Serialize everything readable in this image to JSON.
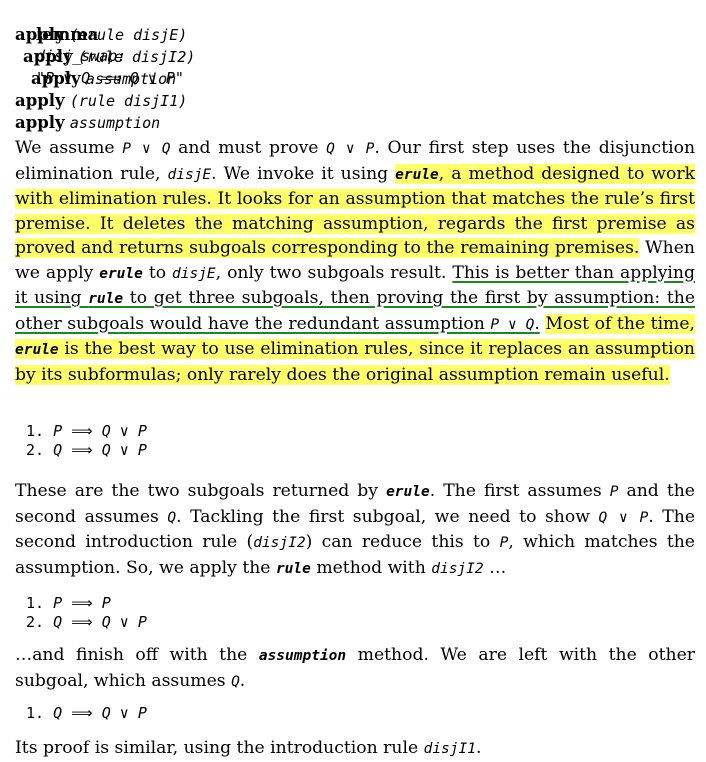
{
  "lemma": {
    "keyword": "lemma",
    "name": "disj_swap:",
    "statement": "\"P ∨ Q ⟹ Q ∨ P\""
  },
  "script": [
    {
      "kw": "apply",
      "arg": "(erule disjE)",
      "indent": 0
    },
    {
      "kw": "apply",
      "arg": "(rule disjI2)",
      "indent": 1
    },
    {
      "kw": "apply",
      "arg": "assumption",
      "indent": 2
    },
    {
      "kw": "apply",
      "arg": "(rule disjI1)",
      "indent": 0
    },
    {
      "kw": "apply",
      "arg": "assumption",
      "indent": 0
    }
  ],
  "para1": {
    "t1": "We assume ",
    "c1": "P ∨ Q",
    "t2": " and must prove ",
    "c2": "Q ∨ P",
    "t3": ". Our first step uses the disjunction elimination rule, ",
    "c3": "disjE",
    "t4": ". We invoke it using ",
    "h1a": "erule",
    "h1b": ", a method designed to work with elimination rules. It looks for an assumption that matches the rule’s first premise. It deletes the matching assumption, regards the first premise as proved and returns subgoals corresponding to the remaining premises.",
    "t5": " When we apply ",
    "c4": "erule",
    "t6": " to ",
    "c5": "disjE",
    "t7": ", only two subgoals result. ",
    "u1": "This is better than applying it using ",
    "uc": "rule",
    "u2": " to get three subgoals, then proving the first by assumption: the other subgoals would have the redundant assumption ",
    "uc2": "P ∨ Q",
    "u3": ".",
    "t8": " ",
    "h2a": "Most of the time, ",
    "h2c": "erule",
    "h2b": " is the best way to use elimination rules, since it replaces an assumption by its subformulas; only rarely does the original assumption remain useful."
  },
  "goals1": [
    {
      "num": "1.",
      "lhs": "P",
      "rhs": "Q ∨ P"
    },
    {
      "num": "2.",
      "lhs": "Q",
      "rhs": "Q ∨ P"
    }
  ],
  "para2": {
    "t1": "These are the two subgoals returned by ",
    "c1": "erule",
    "t2": ". The first assumes ",
    "c2": "P",
    "t3": " and the second assumes ",
    "c3": "Q",
    "t4": ". Tackling the first subgoal, we need to show ",
    "c4": "Q ∨ P",
    "t5": ". The second introduction rule (",
    "c5": "disjI2",
    "t6": ") can reduce this to ",
    "c6": "P",
    "t7": ", which matches the assumption. So, we apply the ",
    "c7": "rule",
    "t8": " method with ",
    "c8": "disjI2",
    "t9": " …"
  },
  "goals2": [
    {
      "num": "1.",
      "lhs": "P",
      "rhs": "P"
    },
    {
      "num": "2.",
      "lhs": "Q",
      "rhs": "Q ∨ P"
    }
  ],
  "para3": {
    "t1": "…and finish off with the ",
    "c1": "assumption",
    "t2": " method. We are left with the other subgoal, which assumes ",
    "c2": "Q",
    "t3": "."
  },
  "goals3": [
    {
      "num": "1.",
      "lhs": "Q",
      "rhs": "Q ∨ P"
    }
  ],
  "para4": {
    "t1": "Its proof is similar, using the introduction rule ",
    "c1": "disjI1",
    "t2": "."
  },
  "arrow": "⟹",
  "colors": {
    "highlight": "#ffff66",
    "underline": "#1a8a1a"
  }
}
